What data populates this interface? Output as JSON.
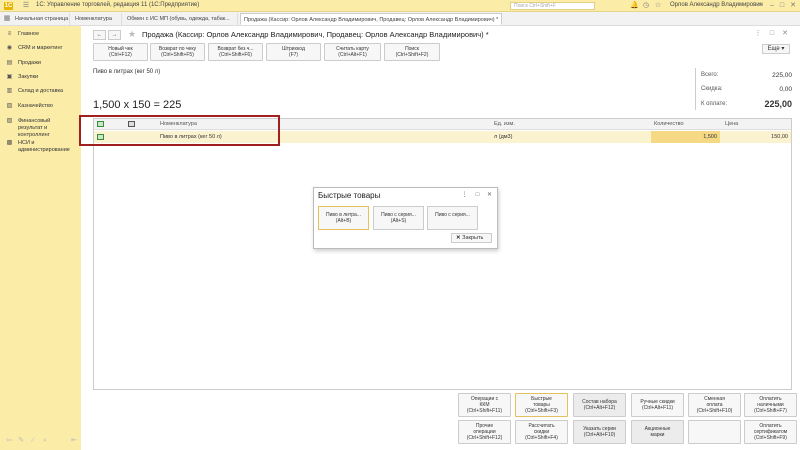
{
  "app": {
    "title": "1С: Управление торговлей, редакция 11  (1С:Предприятие)",
    "search_placeholder": "Поиск Ctrl+Shift+F",
    "user": "Орлов Александр Владимирович"
  },
  "tabs": [
    {
      "label": "Начальная страница"
    },
    {
      "label": "Номенклатура"
    },
    {
      "label": "Обмен с ИС МП (обувь, одежда, табак..."
    },
    {
      "label": "Продажа (Кассир: Орлов Александр Владимирович, Продавец: Орлов Александр Владимирович) *"
    }
  ],
  "sidebar": {
    "items": [
      {
        "label": "Главное",
        "icon": "menu-icon"
      },
      {
        "label": "CRM и маркетинг",
        "icon": "crm-icon"
      },
      {
        "label": "Продажи",
        "icon": "sales-icon"
      },
      {
        "label": "Закупки",
        "icon": "purchases-icon"
      },
      {
        "label": "Склад и доставка",
        "icon": "warehouse-icon"
      },
      {
        "label": "Казначейство",
        "icon": "treasury-icon"
      },
      {
        "label": "Финансовый результат и контроллинг",
        "icon": "finance-icon"
      },
      {
        "label": "НСИ и администрирование",
        "icon": "admin-icon"
      }
    ]
  },
  "document": {
    "title": "Продажа (Кассир: Орлов Александр Владимирович, Продавец: Орлов Александр Владимирович) *",
    "more_label": "Еще",
    "toolbar": [
      {
        "line1": "Новый чек",
        "line2": "(Ctrl+F12)"
      },
      {
        "line1": "Возврат по чеку",
        "line2": "(Ctrl+Shift+F5)"
      },
      {
        "line1": "Возврат без ч...",
        "line2": "(Ctrl+Shift+F6)"
      },
      {
        "line1": "Штрихкод",
        "line2": "(F7)"
      },
      {
        "line1": "Считать карту",
        "line2": "(Ctrl+Alt+F1)"
      },
      {
        "line1": "Поиск",
        "line2": "(Ctrl+Shift+F2)"
      }
    ],
    "current_product": "Пиво в литрах (кег 50 л)",
    "calculation": "1,500 x 150 = 225",
    "totals": {
      "total_label": "Всего:",
      "total_value": "225,00",
      "discount_label": "Скидка:",
      "discount_value": "0,00",
      "pay_label": "К оплате:",
      "pay_value": "225,00"
    }
  },
  "table": {
    "headers": {
      "name": "Номенклатура",
      "unit": "Ед. изм.",
      "qty": "Количество",
      "price": "Цена"
    },
    "rows": [
      {
        "name": "Пиво в литрах (кег 50 л)",
        "unit": "л (дм3)",
        "qty": "1,500",
        "price": "150,00"
      }
    ]
  },
  "popup": {
    "title": "Быстрые товары",
    "buttons": [
      {
        "line1": "Пиво в литра...",
        "line2": "(Alt+B)"
      },
      {
        "line1": "Пиво с серия...",
        "line2": "(Alt+S)"
      },
      {
        "line1": "Пиво с серия...",
        "line2": ""
      }
    ],
    "close_label": "Закрыть"
  },
  "bottom": {
    "row1": [
      {
        "line1": "Операции с",
        "line2": "ККМ",
        "line3": "(Ctrl+Shift+F11)"
      },
      {
        "line1": "Быстрые",
        "line2": "товары",
        "line3": "(Ctrl+Shift+F3)"
      },
      {
        "line1": "Состав набора",
        "line2": "(Ctrl+Alt+F12)",
        "line3": ""
      },
      {
        "line1": "Ручные скидки",
        "line2": "(Ctrl+Alt+F11)",
        "line3": ""
      },
      {
        "line1": "Сменная",
        "line2": "оплата",
        "line3": "(Ctrl+Shift+F10)"
      },
      {
        "line1": "Оплатить",
        "line2": "наличными",
        "line3": "(Ctrl+Shift+F7)"
      }
    ],
    "row2": [
      {
        "line1": "Прочие",
        "line2": "операции",
        "line3": "(Ctrl+Shift+F12)"
      },
      {
        "line1": "Рассчитать",
        "line2": "скидки",
        "line3": "(Ctrl+Shift+F4)"
      },
      {
        "line1": "Указать серии",
        "line2": "(Ctrl+Alt+F10)",
        "line3": ""
      },
      {
        "line1": "Акционные",
        "line2": "марки",
        "line3": ""
      },
      {
        "line1": "",
        "line2": "",
        "line3": ""
      },
      {
        "line1": "Оплатить",
        "line2": "сертификатом",
        "line3": "(Ctrl+Shift+F9)"
      }
    ]
  }
}
